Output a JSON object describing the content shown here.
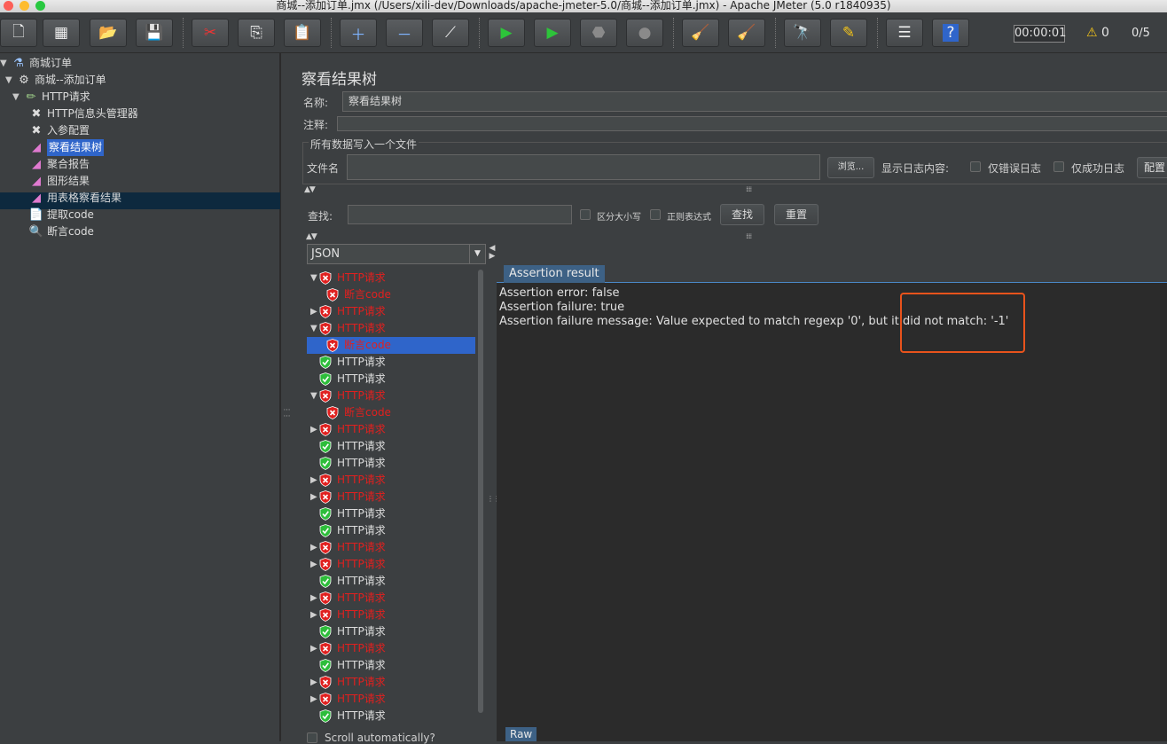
{
  "window": {
    "title": "商城--添加订单.jmx (/Users/xili-dev/Downloads/apache-jmeter-5.0/商城--添加订单.jmx) - Apache JMeter (5.0 r1840935)"
  },
  "toolbar": {
    "timer": "00:00:01",
    "warning_count": "0",
    "thread_ratio": "0/5"
  },
  "left_tree": {
    "items": [
      {
        "label": "商城订单"
      },
      {
        "label": "商城--添加订单"
      },
      {
        "label": "HTTP请求"
      },
      {
        "label": "HTTP信息头管理器"
      },
      {
        "label": "入参配置"
      },
      {
        "label": "察看结果树"
      },
      {
        "label": "聚合报告"
      },
      {
        "label": "图形结果"
      },
      {
        "label": "用表格察看结果"
      },
      {
        "label": "提取code"
      },
      {
        "label": "断言code"
      }
    ]
  },
  "panel": {
    "title": "察看结果树",
    "name_label": "名称:",
    "name_value": "察看结果树",
    "comment_label": "注释:",
    "comment_value": "",
    "file_group_title": "所有数据写入一个文件",
    "filename_label": "文件名",
    "filename_value": "",
    "browse_button": "浏览...",
    "log_display_label": "显示日志内容:",
    "errors_only_label": "仅错误日志",
    "success_only_label": "仅成功日志",
    "configure_button": "配置",
    "search_label": "查找:",
    "search_value": "",
    "case_sensitive_label": "区分大小写",
    "regex_label": "正则表达式",
    "find_button": "查找",
    "reset_button": "重置",
    "renderer_selected": "JSON",
    "scroll_auto_label": "Scroll automatically?"
  },
  "results": {
    "rows": [
      {
        "label": "HTTP请求",
        "status": "fail",
        "expander": "down"
      },
      {
        "label": "断言code",
        "status": "fail",
        "expander": ""
      },
      {
        "label": "HTTP请求",
        "status": "fail",
        "expander": "right"
      },
      {
        "label": "HTTP请求",
        "status": "fail",
        "expander": "down"
      },
      {
        "label": "断言code",
        "status": "fail",
        "expander": ""
      },
      {
        "label": "HTTP请求",
        "status": "ok",
        "expander": ""
      },
      {
        "label": "HTTP请求",
        "status": "ok",
        "expander": ""
      },
      {
        "label": "HTTP请求",
        "status": "fail",
        "expander": "down"
      },
      {
        "label": "断言code",
        "status": "fail",
        "expander": ""
      },
      {
        "label": "HTTP请求",
        "status": "fail",
        "expander": "right"
      },
      {
        "label": "HTTP请求",
        "status": "ok",
        "expander": ""
      },
      {
        "label": "HTTP请求",
        "status": "ok",
        "expander": ""
      },
      {
        "label": "HTTP请求",
        "status": "fail",
        "expander": "right"
      },
      {
        "label": "HTTP请求",
        "status": "fail",
        "expander": "right"
      },
      {
        "label": "HTTP请求",
        "status": "ok",
        "expander": ""
      },
      {
        "label": "HTTP请求",
        "status": "ok",
        "expander": ""
      },
      {
        "label": "HTTP请求",
        "status": "fail",
        "expander": "right"
      },
      {
        "label": "HTTP请求",
        "status": "fail",
        "expander": "right"
      },
      {
        "label": "HTTP请求",
        "status": "ok",
        "expander": ""
      },
      {
        "label": "HTTP请求",
        "status": "fail",
        "expander": "right"
      },
      {
        "label": "HTTP请求",
        "status": "fail",
        "expander": "right"
      },
      {
        "label": "HTTP请求",
        "status": "ok",
        "expander": ""
      },
      {
        "label": "HTTP请求",
        "status": "fail",
        "expander": "right"
      },
      {
        "label": "HTTP请求",
        "status": "ok",
        "expander": ""
      },
      {
        "label": "HTTP请求",
        "status": "fail",
        "expander": "right"
      },
      {
        "label": "HTTP请求",
        "status": "fail",
        "expander": "right"
      },
      {
        "label": "HTTP请求",
        "status": "ok",
        "expander": ""
      }
    ],
    "selected_index": 4
  },
  "detail": {
    "tab_label": "Assertion result",
    "lines": [
      "Assertion error: false",
      "Assertion failure: true",
      "Assertion failure message: Value expected to match regexp '0', but it did not match: '-1'"
    ],
    "raw_tab": "Raw"
  },
  "colors": {
    "fail_text": "#e0201f",
    "selection": "#2f65ca",
    "highlight_box": "#e8531c"
  }
}
